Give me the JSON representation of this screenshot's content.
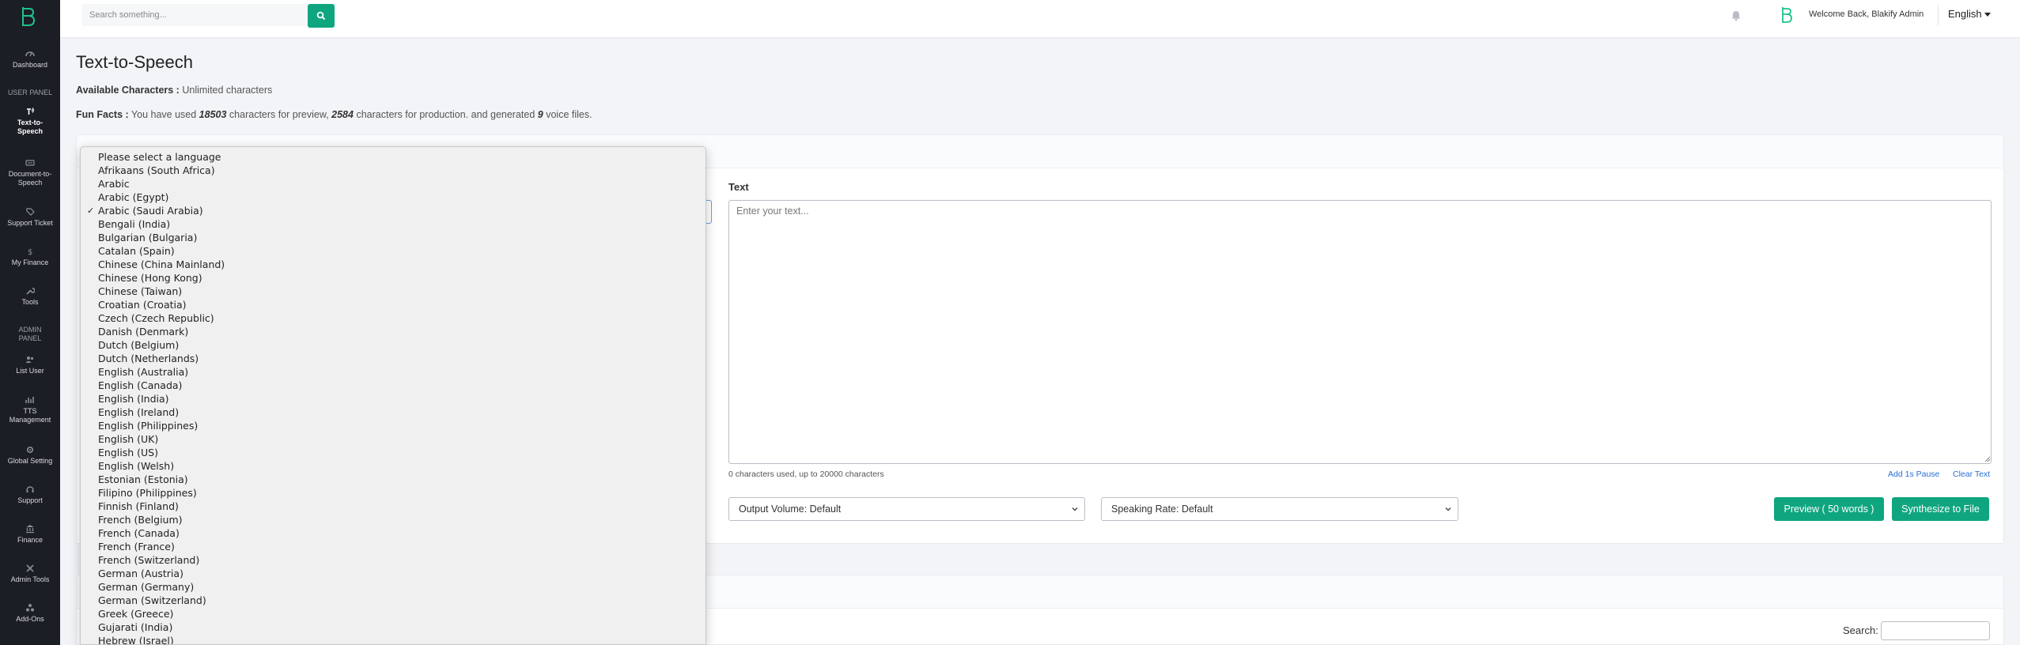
{
  "sidebar": {
    "groups": {
      "user_panel": "USER PANEL",
      "admin_panel_1": "ADMIN",
      "admin_panel_2": "PANEL"
    },
    "items": [
      {
        "label": "Dashboard"
      },
      {
        "label1": "Text-to-",
        "label2": "Speech"
      },
      {
        "label1": "Document-to-",
        "label2": "Speech"
      },
      {
        "label": "Support Ticket"
      },
      {
        "label": "My Finance"
      },
      {
        "label": "Tools"
      },
      {
        "label": "List User"
      },
      {
        "label1": "TTS",
        "label2": "Management"
      },
      {
        "label": "Global Setting"
      },
      {
        "label": "Support"
      },
      {
        "label": "Finance"
      },
      {
        "label": "Admin Tools"
      },
      {
        "label": "Add-Ons"
      }
    ]
  },
  "topbar": {
    "search_placeholder": "Search something...",
    "welcome": "Welcome Back, Blakify Admin",
    "language": "English"
  },
  "page": {
    "title": "Text-to-Speech",
    "available_label": "Available Characters :",
    "available_value": "Unlimited characters",
    "fun_label": "Fun Facts :",
    "fun_1": "You have used",
    "fun_preview_count": "18503",
    "fun_2": "characters for preview,",
    "fun_production_count": "2584",
    "fun_3": "characters for production. and generated",
    "fun_voice_count": "9",
    "fun_4": "voice files."
  },
  "form": {
    "text_label": "Text",
    "text_placeholder": "Enter your text...",
    "char_count": "0 characters used, up to 20000 characters",
    "add_pause": "Add 1s Pause",
    "clear_text": "Clear Text",
    "output_volume": "Output Volume: Default",
    "speaking_rate": "Speaking Rate: Default",
    "preview_button": "Preview ( 50 words )",
    "synthesize_button": "Synthesize to File"
  },
  "table": {
    "search_label": "Search:"
  },
  "language_dropdown": {
    "selected": "Arabic (Saudi Arabia)",
    "options": [
      "Please select a language",
      "Afrikaans (South Africa)",
      "Arabic",
      "Arabic (Egypt)",
      "Arabic (Saudi Arabia)",
      "Bengali (India)",
      "Bulgarian (Bulgaria)",
      "Catalan (Spain)",
      "Chinese (China Mainland)",
      "Chinese (Hong Kong)",
      "Chinese (Taiwan)",
      "Croatian (Croatia)",
      "Czech (Czech Republic)",
      "Danish (Denmark)",
      "Dutch (Belgium)",
      "Dutch (Netherlands)",
      "English (Australia)",
      "English (Canada)",
      "English (India)",
      "English (Ireland)",
      "English (Philippines)",
      "English (UK)",
      "English (US)",
      "English (Welsh)",
      "Estonian (Estonia)",
      "Filipino (Philippines)",
      "Finnish (Finland)",
      "French (Belgium)",
      "French (Canada)",
      "French (France)",
      "French (Switzerland)",
      "German (Austria)",
      "German (Germany)",
      "German (Switzerland)",
      "Greek (Greece)",
      "Gujarati (India)",
      "Hebrew (Israel)"
    ]
  },
  "colors": {
    "accent": "#0fa67f",
    "sidebar_bg": "#1b1e24",
    "link": "#2a6fd6"
  }
}
